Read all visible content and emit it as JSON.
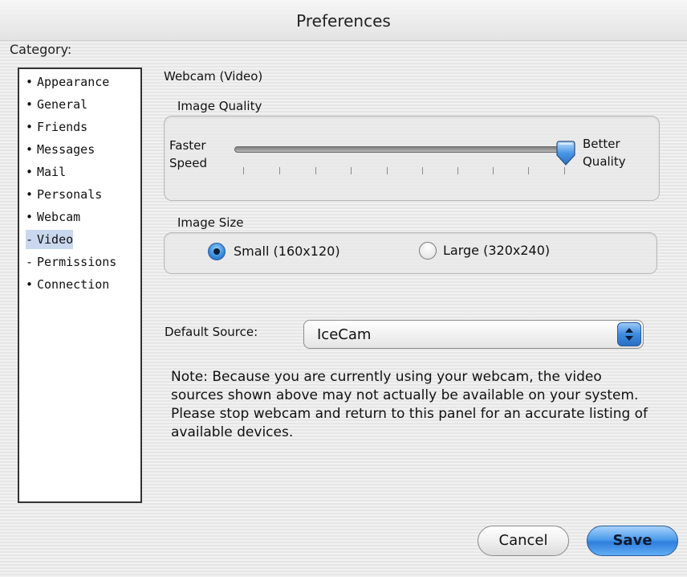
{
  "window": {
    "title": "Preferences"
  },
  "sidebar": {
    "label": "Category:",
    "items": [
      {
        "mark": "•",
        "label": "Appearance"
      },
      {
        "mark": "•",
        "label": "General"
      },
      {
        "mark": "•",
        "label": "Friends"
      },
      {
        "mark": "•",
        "label": "Messages"
      },
      {
        "mark": "•",
        "label": "Mail"
      },
      {
        "mark": "•",
        "label": "Personals"
      },
      {
        "mark": "•",
        "label": "Webcam"
      },
      {
        "mark": "-",
        "label": "Video",
        "selected": true
      },
      {
        "mark": "-",
        "label": "Permissions"
      },
      {
        "mark": "•",
        "label": "Connection"
      }
    ]
  },
  "panel": {
    "title": "Webcam (Video)",
    "image_quality": {
      "label": "Image Quality",
      "left_label_1": "Faster",
      "left_label_2": "Speed",
      "right_label_1": "Better",
      "right_label_2": "Quality",
      "value_percent": 100
    },
    "image_size": {
      "label": "Image Size",
      "options": [
        {
          "label": "Small (160x120)",
          "selected": true
        },
        {
          "label": "Large (320x240)",
          "selected": false
        }
      ]
    },
    "default_source": {
      "label": "Default Source:",
      "value": "IceCam"
    },
    "note": "Note: Because you are currently using your webcam, the video sources shown above may not actually be available on your system.  Please stop webcam and return to this panel for an accurate listing of available devices."
  },
  "buttons": {
    "cancel": "Cancel",
    "save": "Save"
  },
  "colors": {
    "accent_blue": "#3e8be0",
    "selected_row": "#c9d8ee"
  }
}
